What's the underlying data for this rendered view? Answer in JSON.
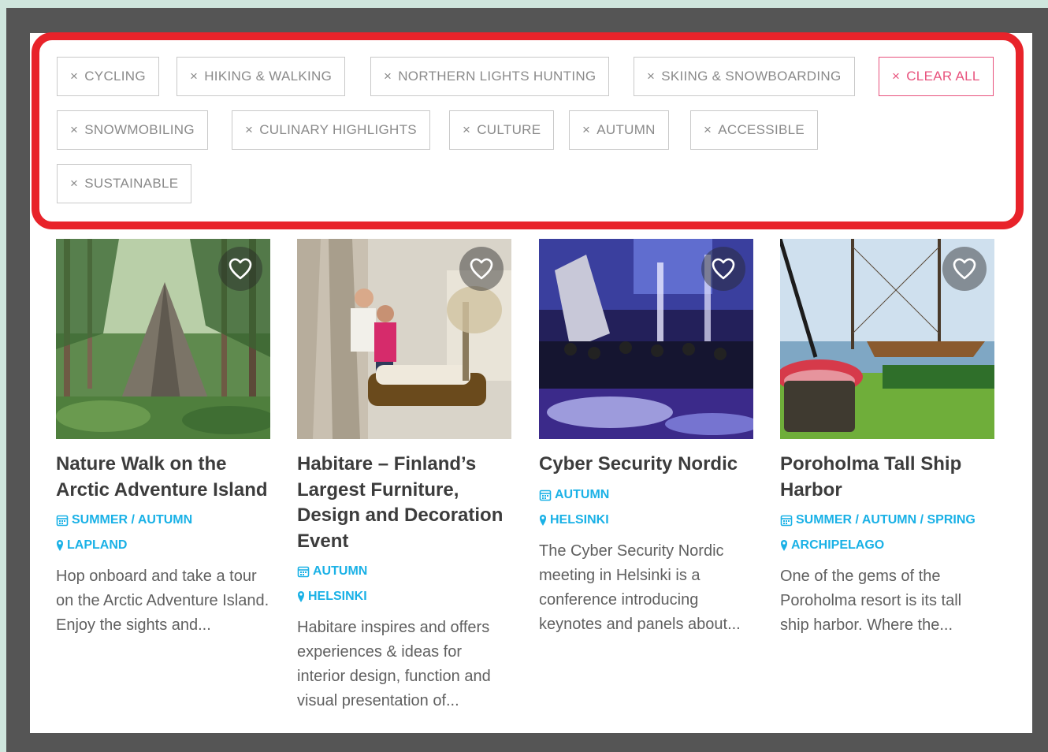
{
  "filters": {
    "chips": [
      {
        "label": "CYCLING"
      },
      {
        "label": "HIKING & WALKING"
      },
      {
        "label": "NORTHERN LIGHTS HUNTING"
      },
      {
        "label": "SKIING & SNOWBOARDING"
      },
      {
        "label": "SNOWMOBILING"
      },
      {
        "label": "CULINARY HIGHLIGHTS"
      },
      {
        "label": "CULTURE"
      },
      {
        "label": "AUTUMN"
      },
      {
        "label": "ACCESSIBLE"
      },
      {
        "label": "SUSTAINABLE"
      }
    ],
    "remove_glyph": "×",
    "clear_all_label": "CLEAR ALL"
  },
  "cards": [
    {
      "title": "Nature Walk on the Arctic Adventure Island",
      "season": "SUMMER / AUTUMN",
      "location": "LAPLAND",
      "description": "Hop onboard and take a tour on the Arctic Adventure Island. Enjoy the sights and..."
    },
    {
      "title": "Habitare – Finland’s Largest Furniture, Design and Decoration Event",
      "season": "AUTUMN",
      "location": "HELSINKI",
      "description": "Habitare inspires and offers experiences & ideas for interior design, function and visual presentation of..."
    },
    {
      "title": "Cyber Security Nordic",
      "season": "AUTUMN",
      "location": "HELSINKI",
      "description": "The Cyber Security Nordic meeting in Helsinki is a conference introducing keynotes and panels about..."
    },
    {
      "title": "Poroholma Tall Ship Harbor",
      "season": "SUMMER / AUTUMN / SPRING",
      "location": "ARCHIPELAGO",
      "description": "One of the gems of the Poroholma resort is its tall ship harbor. Where the..."
    }
  ],
  "colors": {
    "highlight_border": "#e8232a",
    "clear_all": "#e8527d",
    "meta_blue": "#1ab1e6",
    "title": "#3c3c3c"
  },
  "icons": {
    "favorite": "heart-icon",
    "season": "calendar-icon",
    "location": "map-pin-icon"
  }
}
